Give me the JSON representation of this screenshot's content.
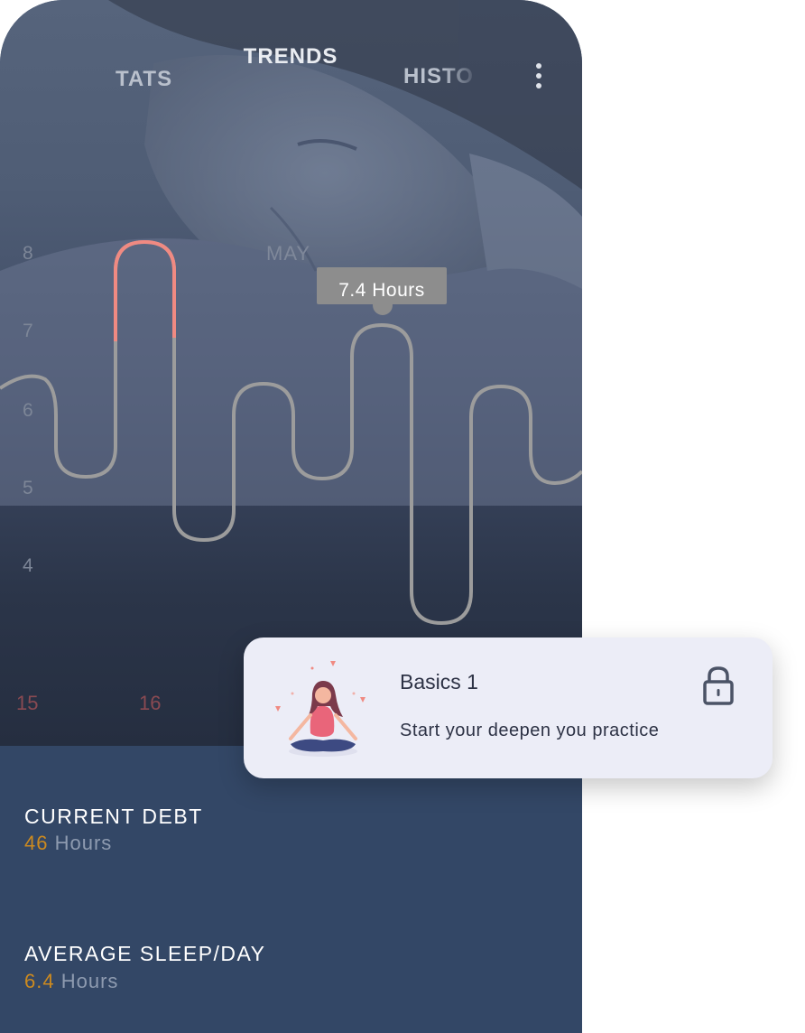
{
  "tabs": [
    {
      "label": "STATS",
      "shown": "TATS"
    },
    {
      "label": "TRENDS",
      "active": true
    },
    {
      "label": "HISTORY",
      "shown": "HISTO"
    }
  ],
  "chart_data": {
    "type": "line",
    "month": "MAY",
    "yticks": [
      "8",
      "7",
      "6",
      "5",
      "4"
    ],
    "xticks": [
      "15",
      "16"
    ],
    "tooltip": "7.4 Hours",
    "highlight_color": "#f08a82",
    "line_color": "#9c9c9c"
  },
  "card": {
    "title": "Basics 1",
    "subtitle": "Start your deepen you practice",
    "icon": "lock-icon",
    "illustration": "meditation-illustration"
  },
  "stats": {
    "current_debt": {
      "label": "CURRENT DEBT",
      "value": "46",
      "unit": "Hours"
    },
    "average_sleep": {
      "label": "AVERAGE SLEEP/DAY",
      "value": "6.4",
      "unit": "Hours"
    }
  },
  "colors": {
    "accent": "#cc8a1f",
    "panel": "#334766",
    "card": "#ecedf7"
  }
}
